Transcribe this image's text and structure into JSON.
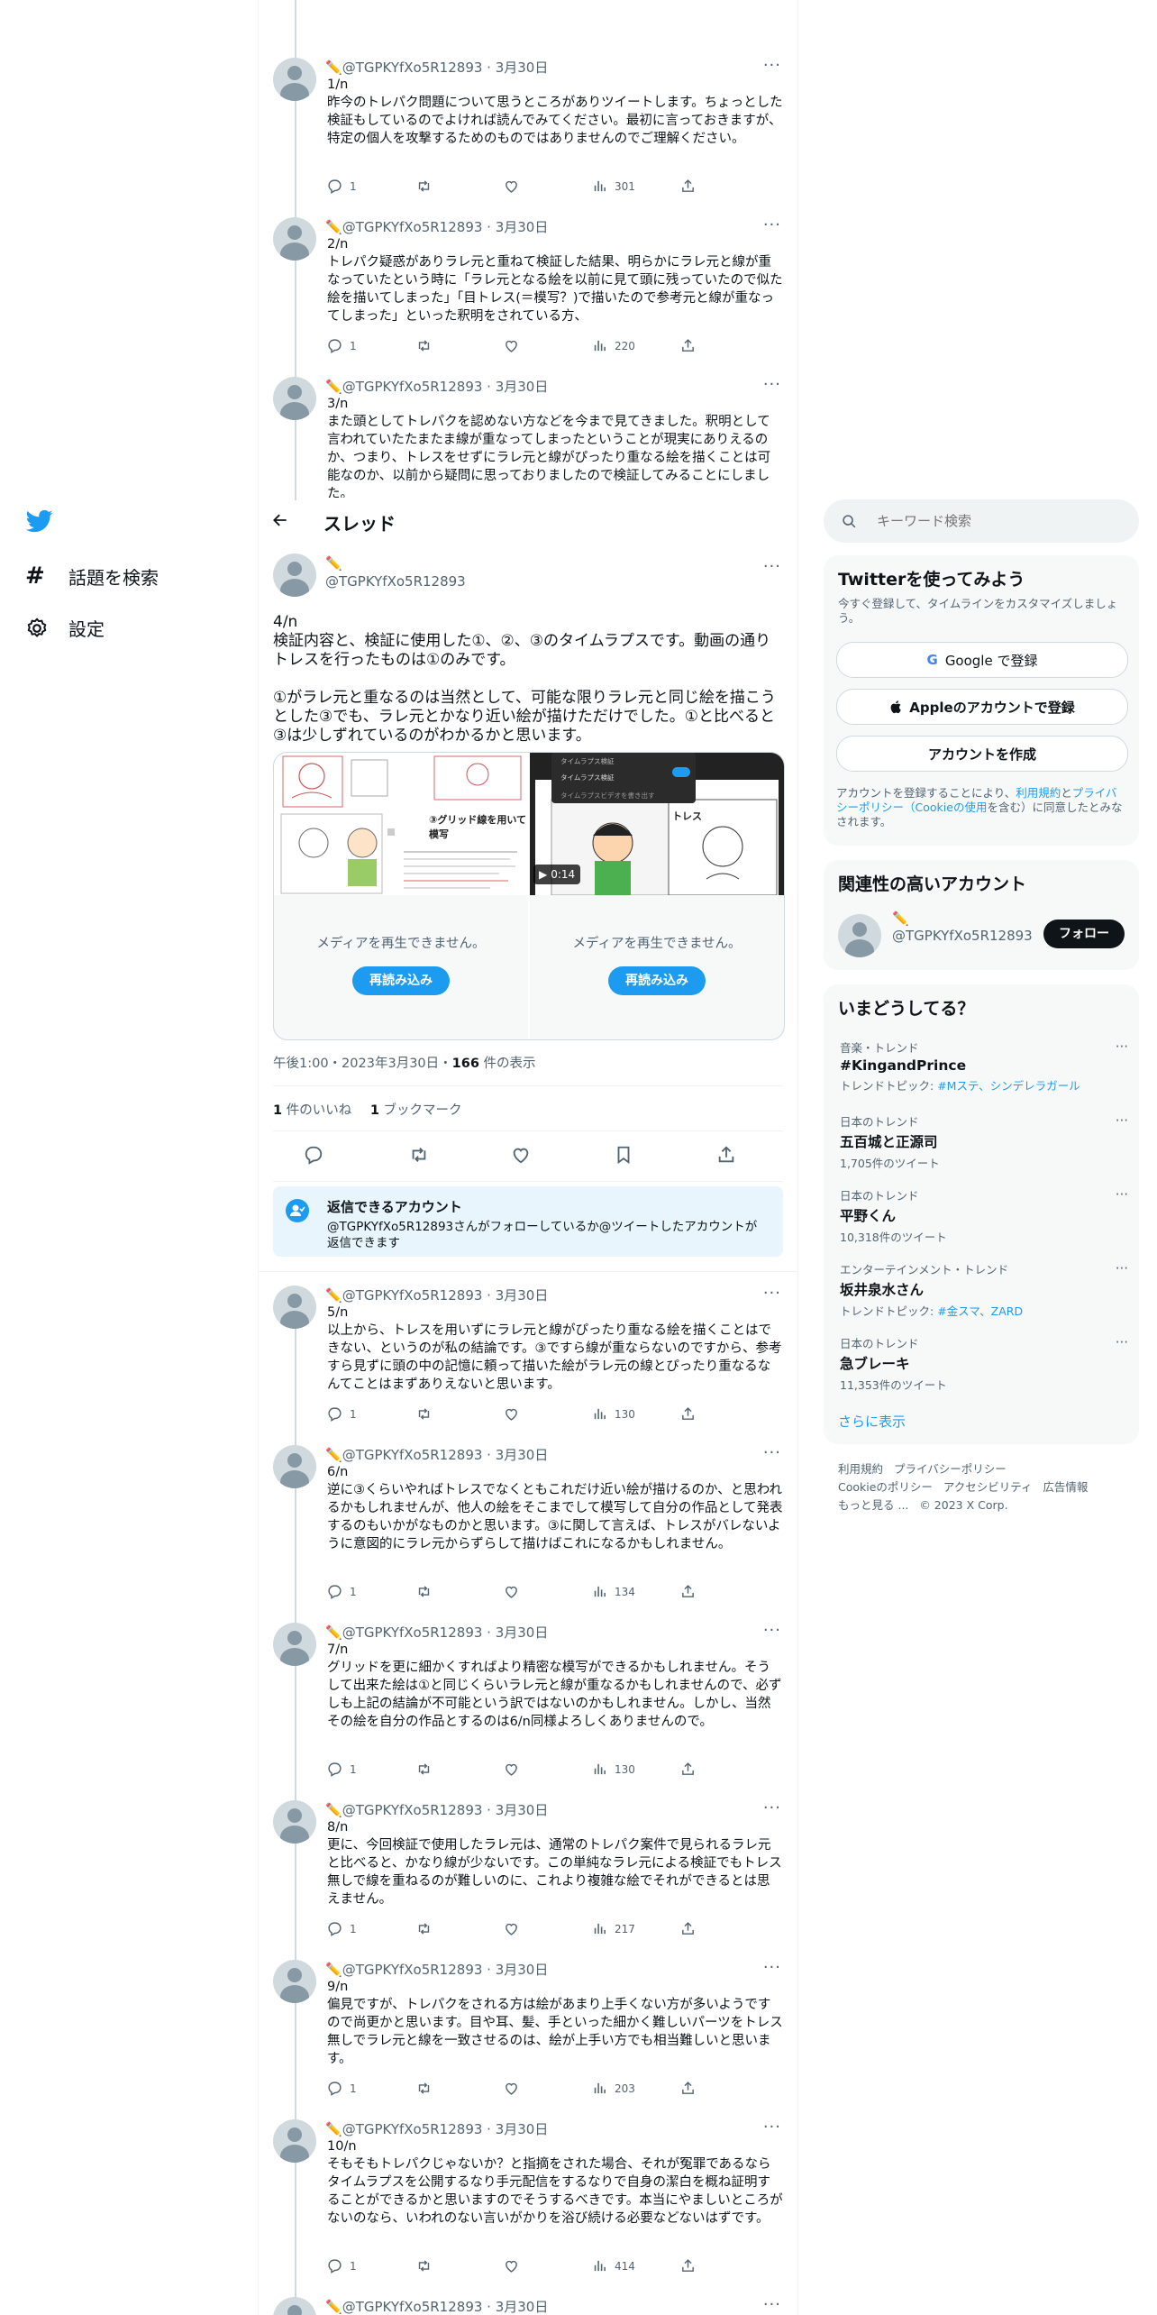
{
  "nav": {
    "explore_label": "話題を検索",
    "settings_label": "設定"
  },
  "header": {
    "title": "スレッド"
  },
  "author": {
    "emoji": "✏️",
    "handle": "@TGPKYfXo5R12893",
    "date": "3月30日"
  },
  "tweets_above": [
    {
      "num": "1/n",
      "text": "昨今のトレパク問題について思うところがありツイートします。ちょっとした検証もしているのでよければ読んでみてください。最初に言っておきますが、特定の個人を攻撃するためのものではありませんのでご理解ください。",
      "replies": "1",
      "views": "301"
    },
    {
      "num": "2/n",
      "text": "トレパク疑惑がありラレ元と重ねて検証した結果、明らかにラレ元と線が重なっていたという時に「ラレ元となる絵を以前に見て頭に残っていたので似た絵を描いてしまった」「目トレス(＝模写？)で描いたので参考元と線が重なってしまった」といった釈明をされている方、",
      "replies": "1",
      "views": "220"
    },
    {
      "num": "3/n",
      "text": "また頭としてトレパクを認めない方などを今まで見てきました。釈明として言われていたたまたま線が重なってしまったということが現実にありえるのか、つまり、トレスをせずにラレ元と線がぴったり重なる絵を描くことは可能なのか、以前から疑問に思っておりましたので検証してみることにしました。",
      "replies": "",
      "views": ""
    }
  ],
  "main_tweet": {
    "num": "4/n",
    "text_1": "検証内容と、検証に使用した①、②、③のタイムラプスです。動画の通りトレスを行ったものは①のみです。",
    "text_2": "①がラレ元と重なるのは当然として、可能な限りラレ元と同じ絵を描こうとした③でも、ラレ元とかなり近い絵が描けただけでした。①と比べると③は少しずれているのがわかるかと思います。",
    "media_error": "メディアを再生できません。",
    "reload_label": "再読み込み",
    "video_duration": "0:14",
    "grid_caption": "③グリッド線を用いて模写",
    "trace_caption": "トレス",
    "menu_items": [
      "タイムラプス検証",
      "タイムラプス検証",
      "タイムラプスビデオを書き出す"
    ],
    "timestamp": "午後1:00・2023年3月30日・",
    "views": "166",
    "views_suffix": " 件の表示",
    "likes": "1",
    "likes_label": " 件のいいね",
    "bookmarks": "1",
    "bookmarks_label": " ブックマーク"
  },
  "reply_notice": {
    "title": "返信できるアカウント",
    "text": "@TGPKYfXo5R12893さんがフォローしているか@ツイートしたアカウントが返信できます"
  },
  "tweets_below": [
    {
      "num": "5/n",
      "text": "以上から、トレスを用いずにラレ元と線がぴったり重なる絵を描くことはできない、というのが私の結論です。③ですら線が重ならないのですから、参考すら見ずに頭の中の記憶に頼って描いた絵がラレ元の線とぴったり重なるなんてことはまずありえないと思います。",
      "replies": "1",
      "views": "130"
    },
    {
      "num": "6/n",
      "text": "逆に③くらいやればトレスでなくともこれだけ近い絵が描けるのか、と思われるかもしれませんが、他人の絵をそこまでして模写して自分の作品として発表するのもいかがなものかと思います。③に関して言えば、トレスがバレないように意図的にラレ元からずらして描けばこれになるかもしれません。",
      "replies": "1",
      "views": "134"
    },
    {
      "num": "7/n",
      "text": "グリッドを更に細かくすればより精密な模写ができるかもしれません。そうして出来た絵は①と同じくらいラレ元と線が重なるかもしれませんので、必ずしも上記の結論が不可能という訳ではないのかもしれません。しかし、当然その絵を自分の作品とするのは6/n同様よろしくありませんので。",
      "replies": "1",
      "views": "130"
    },
    {
      "num": "8/n",
      "text": "更に、今回検証で使用したラレ元は、通常のトレパク案件で見られるラレ元と比べると、かなり線が少ないです。この単純なラレ元による検証でもトレス無しで線を重ねるのが難しいのに、これより複雑な絵でそれができるとは思えません。",
      "replies": "1",
      "views": "217"
    },
    {
      "num": "9/n",
      "text": "偏見ですが、トレパクをされる方は絵があまり上手くない方が多いようですので尚更かと思います。目や耳、髪、手といった細かく難しいパーツをトレス無しでラレ元と線を一致させるのは、絵が上手い方でも相当難しいと思います。",
      "replies": "1",
      "views": "203"
    },
    {
      "num": "10/n",
      "text": "そもそもトレパクじゃないか？と指摘をされた場合、それが冤罪であるならタイムラプスを公開するなり手元配信をするなりで自身の潔白を概ね証明することができるかと思いますのでそうするべきです。本当にやましいところがないのなら、いわれのない言いがかりを浴び続ける必要などないはずです。",
      "replies": "1",
      "views": "414"
    }
  ],
  "search": {
    "placeholder": "キーワード検索"
  },
  "signup": {
    "title": "Twitterを使ってみよう",
    "subtitle": "今すぐ登録して、タイムラインをカスタマイズしましょう。",
    "google_label": "Google で登録",
    "apple_label": "Appleのアカウントで登録",
    "create_label": "アカウントを作成",
    "terms_prefix": "アカウントを登録することにより、",
    "terms_link": "利用規約",
    "terms_and": "と",
    "privacy_link": "プライバシーポリシー",
    "cookie_link": "（Cookieの使用",
    "terms_suffix": "を含む）に同意したとみなされます。"
  },
  "relevant": {
    "title": "関連性の高いアカウント",
    "emoji": "✏️",
    "handle": "@TGPKYfXo5R12893",
    "follow_label": "フォロー"
  },
  "trends": {
    "title": "いまどうしてる？",
    "items": [
      {
        "meta": "音楽・トレンド",
        "name": "#KingandPrince",
        "sub_prefix": "トレンドトピック: ",
        "sub_link": "#Mステ、シンデレラガール",
        "sub": ""
      },
      {
        "meta": "日本のトレンド",
        "name": "五百城と正源司",
        "sub_prefix": "",
        "sub_link": "",
        "sub": "1,705件のツイート"
      },
      {
        "meta": "日本のトレンド",
        "name": "平野くん",
        "sub_prefix": "",
        "sub_link": "",
        "sub": "10,318件のツイート"
      },
      {
        "meta": "エンターテインメント・トレンド",
        "name": "坂井泉水さん",
        "sub_prefix": "トレンドトピック: ",
        "sub_link": "#金スマ、ZARD",
        "sub": ""
      },
      {
        "meta": "日本のトレンド",
        "name": "急ブレーキ",
        "sub_prefix": "",
        "sub_link": "",
        "sub": "11,353件のツイート"
      }
    ],
    "show_more": "さらに表示"
  },
  "footer": {
    "links": [
      "利用規約",
      "プライバシーポリシー",
      "Cookieのポリシー",
      "アクセシビリティ",
      "広告情報",
      "もっと見る ..."
    ],
    "copyright": "© 2023 X Corp."
  },
  "colors": {
    "accent": "#1d9bf0",
    "text_primary": "#0f1419",
    "text_secondary": "#536471",
    "border": "#eff3f4",
    "card_bg": "#f7f9f9"
  }
}
